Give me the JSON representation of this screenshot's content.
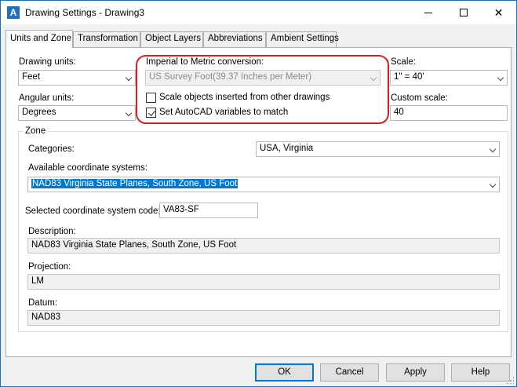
{
  "window": {
    "title": "Drawing Settings - Drawing3",
    "app_icon": "A",
    "controls": {
      "minimize": "minimize-icon",
      "maximize": "maximize-icon",
      "close": "✕"
    }
  },
  "tabs": [
    {
      "label": "Units and Zone",
      "active": true
    },
    {
      "label": "Transformation"
    },
    {
      "label": "Object Layers"
    },
    {
      "label": "Abbreviations"
    },
    {
      "label": "Ambient Settings"
    }
  ],
  "units": {
    "drawing_units_label": "Drawing units:",
    "drawing_units_value": "Feet",
    "angular_units_label": "Angular units:",
    "angular_units_value": "Degrees",
    "imperial_label": "Imperial to Metric conversion:",
    "imperial_value": "US Survey Foot(39.37 Inches per Meter)",
    "scale_objects_label": "Scale objects inserted from other drawings",
    "scale_objects_checked": false,
    "set_variables_label": "Set AutoCAD variables to match",
    "set_variables_checked": true,
    "scale_label": "Scale:",
    "scale_value": "1\" = 40'",
    "custom_scale_label": "Custom scale:",
    "custom_scale_value": "40"
  },
  "zone": {
    "group_label": "Zone",
    "categories_label": "Categories:",
    "categories_value": "USA, Virginia",
    "available_label": "Available coordinate systems:",
    "available_value": "NAD83 Virginia State Planes, South Zone, US Foot",
    "code_label": "Selected coordinate system code:",
    "code_value": "VA83-SF",
    "description_label": "Description:",
    "description_value": "NAD83 Virginia State Planes, South Zone, US Foot",
    "projection_label": "Projection:",
    "projection_value": "LM",
    "datum_label": "Datum:",
    "datum_value": "NAD83"
  },
  "buttons": {
    "ok": "OK",
    "cancel": "Cancel",
    "apply": "Apply",
    "help": "Help"
  },
  "colors": {
    "accent": "#0078d7",
    "callout": "#e11b22",
    "title_border": "#1f6fb5"
  }
}
